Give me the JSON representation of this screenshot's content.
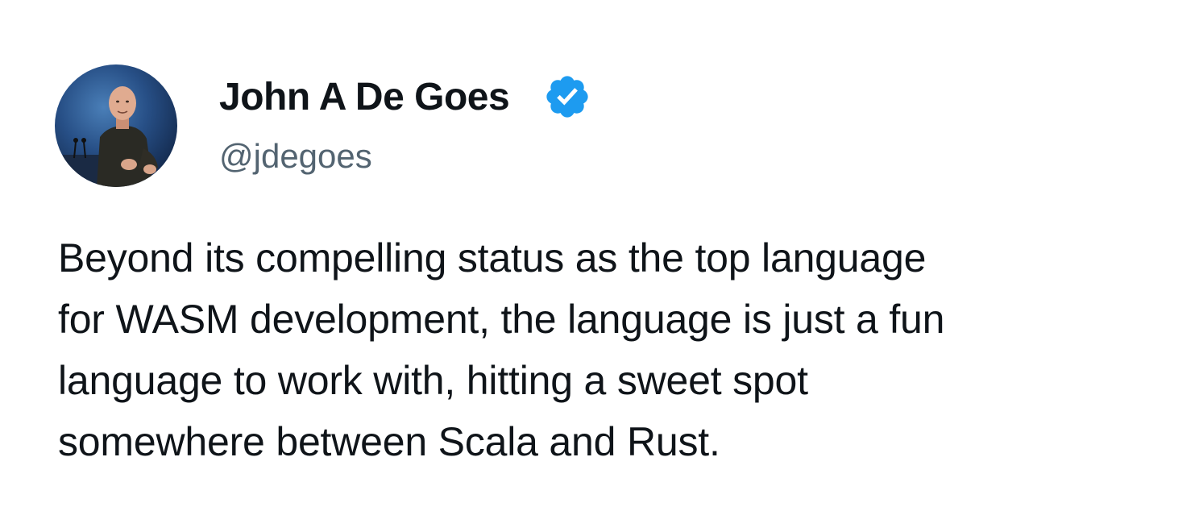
{
  "author": {
    "display_name": "John A De Goes",
    "handle": "@jdegoes",
    "verified": true,
    "verified_color": "#1d9bf0",
    "avatar_icon": "speaker-photo-avatar"
  },
  "tweet": {
    "lines": [
      "Beyond its compelling status as the top language",
      "for WASM development, the language is just a fun",
      "language to work with, hitting a sweet spot",
      "somewhere between Scala and Rust."
    ]
  },
  "colors": {
    "text_primary": "#0f1419",
    "text_secondary": "#536471",
    "background": "#ffffff"
  }
}
